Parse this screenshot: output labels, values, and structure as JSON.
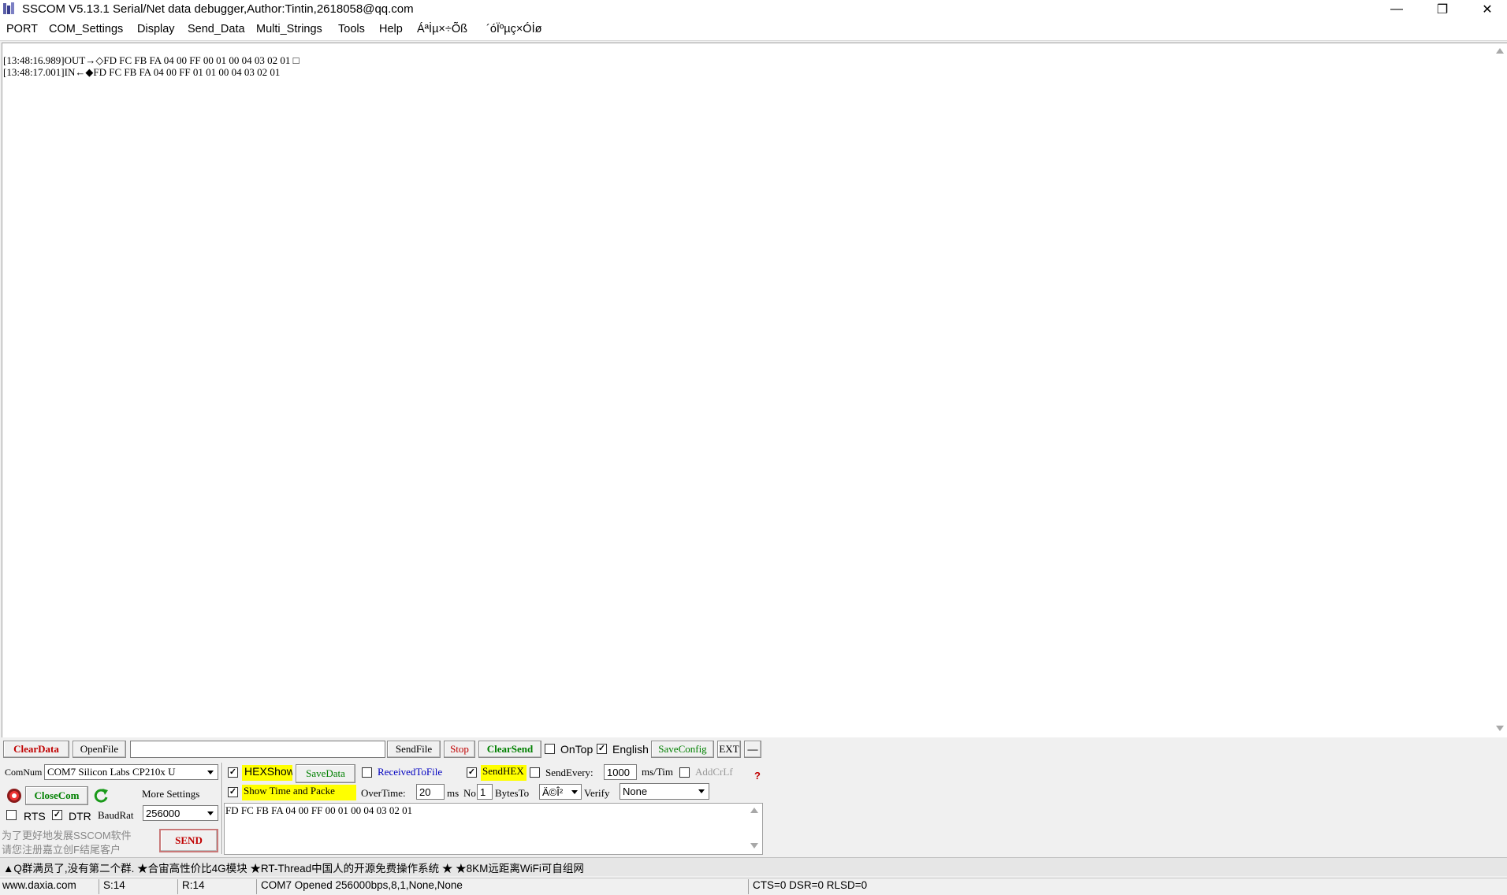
{
  "window": {
    "title": "SSCOM V5.13.1 Serial/Net data debugger,Author:Tintin,2618058@qq.com",
    "minimize_glyph": "—",
    "maximize_glyph": "❐",
    "close_glyph": "✕"
  },
  "menu": [
    "PORT",
    "COM_Settings",
    "Display",
    "Send_Data",
    "Multi_Strings",
    "Tools",
    "Help",
    "Áªİµ×÷Õß",
    "´óÏºµç×Óİø"
  ],
  "receive": {
    "lines": [
      "[13:48:16.989]OUT→◇FD FC FB FA 04 00 FF 00 01 00 04 03 02 01 □",
      "[13:48:17.001]IN←◆FD FC FB FA 04 00 FF 01 01 00 04 03 02 01"
    ]
  },
  "toolbar": {
    "clear_data": "ClearData",
    "open_file": "OpenFile",
    "file_path": "",
    "send_file": "SendFile",
    "stop": "Stop",
    "clear_send": "ClearSend",
    "on_top": "OnTop",
    "on_top_checked": false,
    "english": "English",
    "english_checked": true,
    "save_config": "SaveConfig",
    "ext": "EXT",
    "collapse": "—"
  },
  "port": {
    "comnum_label": "ComNum",
    "comnum_value": "COM7 Silicon Labs CP210x U",
    "close_com": "CloseCom",
    "more_settings": "More Settings",
    "rts": "RTS",
    "rts_checked": false,
    "dtr": "DTR",
    "dtr_checked": true,
    "baud_label": "BaudRat",
    "baud_value": "256000",
    "promo_line1": "为了更好地发展SSCOM软件",
    "promo_line2": "请您注册嘉立创F结尾客户",
    "send": "SEND"
  },
  "options": {
    "hex_show": "HEXShow",
    "hex_show_checked": true,
    "save_data": "SaveData",
    "received_to_file": "ReceivedToFile",
    "received_to_file_checked": false,
    "send_hex": "SendHEX",
    "send_hex_checked": true,
    "send_every": "SendEvery:",
    "send_every_checked": false,
    "send_every_value": "1000",
    "ms_tim": "ms/Tim",
    "add_crlf": "AddCrLf",
    "add_crlf_checked": false,
    "help_mark": "?",
    "show_time": "Show Time and Packe",
    "show_time_checked": true,
    "overtime_label": "OverTime:",
    "overtime_value": "20",
    "ms": "ms",
    "no_label": "No",
    "no_value": "1",
    "bytes_to": "BytesTo",
    "bytes_to_value": "Ä©Î²",
    "verify_label": "Verify",
    "verify_value": "None"
  },
  "send_area": {
    "text": "FD FC FB FA 04 00 FF 00 01 00 04 03 02 01"
  },
  "ticker": "▲Q群满员了,没有第二个群. ★合宙高性价比4G模块 ★RT-Thread中国人的开源免费操作系统 ★ ★8KM远距离WiFi可自组网",
  "status": {
    "website": "www.daxia.com",
    "sent": "S:14",
    "received": "R:14",
    "port_status": "COM7 Opened  256000bps,8,1,None,None",
    "lines": "CTS=0 DSR=0 RLSD=0"
  },
  "colors": {
    "highlight": "#ffff00",
    "clear_data_text": "#c00000",
    "green_text": "#008000",
    "blue_text": "#0000c0"
  }
}
